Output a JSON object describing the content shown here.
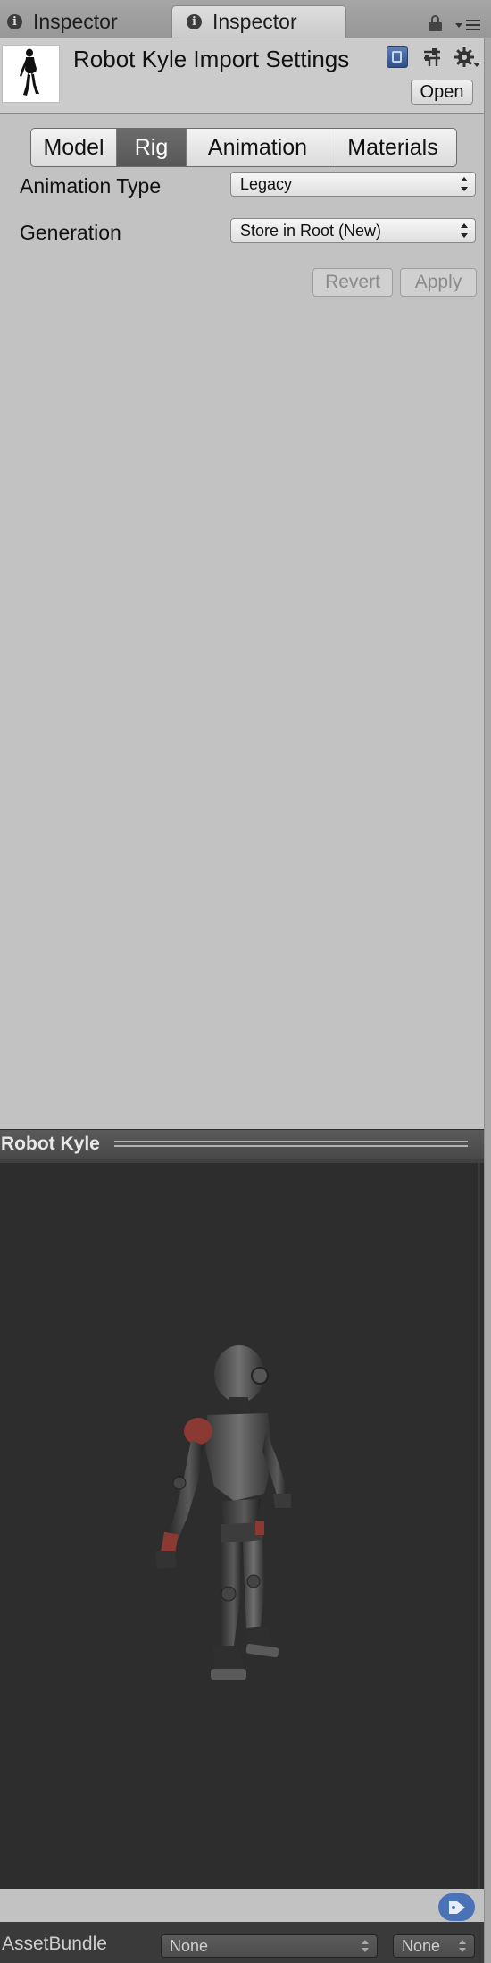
{
  "tabs": [
    {
      "label": "Inspector"
    },
    {
      "label": "Inspector"
    }
  ],
  "header": {
    "title": "Robot Kyle Import Settings",
    "open_label": "Open",
    "icons": [
      "help-book-icon",
      "preset-sliders-icon",
      "gear-icon"
    ]
  },
  "rig_tabs": {
    "items": [
      {
        "label": "Model"
      },
      {
        "label": "Rig"
      },
      {
        "label": "Animation"
      },
      {
        "label": "Materials"
      }
    ],
    "selected": "Rig"
  },
  "properties": {
    "animation_type": {
      "label": "Animation Type",
      "value": "Legacy"
    },
    "generation": {
      "label": "Generation",
      "value": "Store in Root (New)"
    }
  },
  "actions": {
    "revert_label": "Revert",
    "apply_label": "Apply"
  },
  "preview": {
    "title": "Robot Kyle"
  },
  "asset_bundle": {
    "label": "AssetBundle",
    "name_value": "None",
    "variant_value": "None"
  },
  "colors": {
    "panel_bg": "#c2c2c2",
    "preview_bg": "#2d2d2d",
    "selected_tab": "#5e5e5e",
    "tag_button": "#4a72b6"
  }
}
